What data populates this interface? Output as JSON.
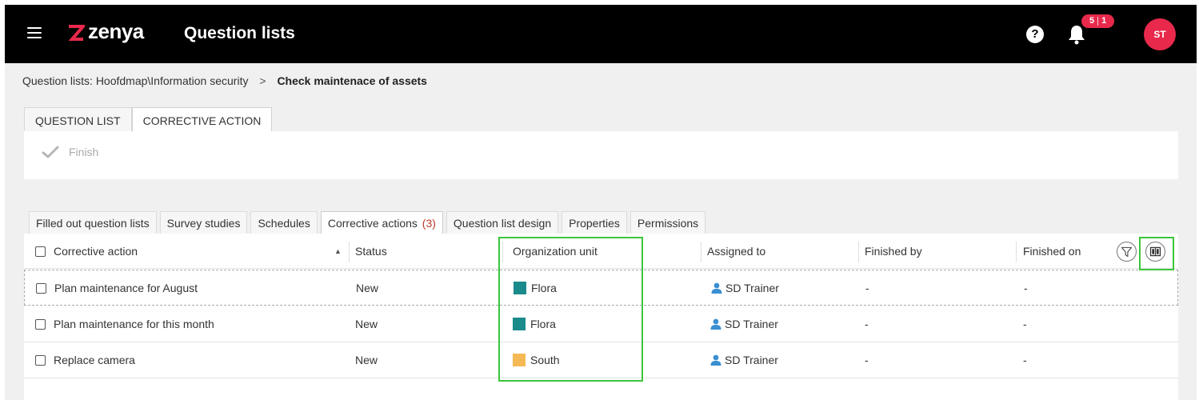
{
  "header": {
    "logo_text": "zenya",
    "title": "Question lists",
    "help_label": "?",
    "notification_badges": [
      "5",
      "1"
    ],
    "avatar_initials": "ST",
    "colors": {
      "bar": "#000000",
      "brand": "#e8294c"
    }
  },
  "breadcrumb": {
    "path": "Question lists: Hoofdmap\\Information security",
    "separator": ">",
    "current": "Check maintenace of assets"
  },
  "top_tabs": [
    {
      "label": "QUESTION LIST",
      "active": false
    },
    {
      "label": "CORRECTIVE ACTION",
      "active": true
    }
  ],
  "toolbar": {
    "finish_label": "Finish"
  },
  "sub_tabs": [
    {
      "label": "Filled out question lists"
    },
    {
      "label": "Survey studies"
    },
    {
      "label": "Schedules"
    },
    {
      "label": "Corrective actions",
      "count": "(3)",
      "active": true
    },
    {
      "label": "Question list design"
    },
    {
      "label": "Properties"
    },
    {
      "label": "Permissions"
    }
  ],
  "table": {
    "columns": [
      "Corrective action",
      "Status",
      "Organization unit",
      "Assigned to",
      "Finished by",
      "Finished on"
    ],
    "rows": [
      {
        "action": "Plan maintenance for August",
        "status": "New",
        "org_unit": "Flora",
        "org_color": "#1a8a8a",
        "assigned_to": "SD Trainer",
        "finished_by": "-",
        "finished_on": "-"
      },
      {
        "action": "Plan maintenance for this month",
        "status": "New",
        "org_unit": "Flora",
        "org_color": "#1a8a8a",
        "assigned_to": "SD Trainer",
        "finished_by": "-",
        "finished_on": "-"
      },
      {
        "action": "Replace camera",
        "status": "New",
        "org_unit": "South",
        "org_color": "#f5b955",
        "assigned_to": "SD Trainer",
        "finished_by": "-",
        "finished_on": "-"
      }
    ]
  },
  "highlight_color": "#3bc63b"
}
